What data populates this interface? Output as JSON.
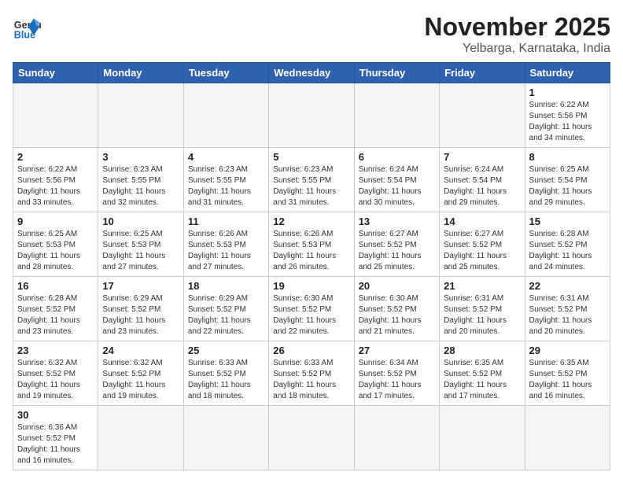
{
  "logo": {
    "text_general": "General",
    "text_blue": "Blue"
  },
  "title": "November 2025",
  "location": "Yelbarga, Karnataka, India",
  "weekdays": [
    "Sunday",
    "Monday",
    "Tuesday",
    "Wednesday",
    "Thursday",
    "Friday",
    "Saturday"
  ],
  "days": [
    {
      "num": "",
      "sunrise": "",
      "sunset": "",
      "daylight": ""
    },
    {
      "num": "",
      "sunrise": "",
      "sunset": "",
      "daylight": ""
    },
    {
      "num": "",
      "sunrise": "",
      "sunset": "",
      "daylight": ""
    },
    {
      "num": "",
      "sunrise": "",
      "sunset": "",
      "daylight": ""
    },
    {
      "num": "",
      "sunrise": "",
      "sunset": "",
      "daylight": ""
    },
    {
      "num": "",
      "sunrise": "",
      "sunset": "",
      "daylight": ""
    },
    {
      "num": "1",
      "sunrise": "Sunrise: 6:22 AM",
      "sunset": "Sunset: 5:56 PM",
      "daylight": "Daylight: 11 hours and 34 minutes."
    },
    {
      "num": "2",
      "sunrise": "Sunrise: 6:22 AM",
      "sunset": "Sunset: 5:56 PM",
      "daylight": "Daylight: 11 hours and 33 minutes."
    },
    {
      "num": "3",
      "sunrise": "Sunrise: 6:23 AM",
      "sunset": "Sunset: 5:55 PM",
      "daylight": "Daylight: 11 hours and 32 minutes."
    },
    {
      "num": "4",
      "sunrise": "Sunrise: 6:23 AM",
      "sunset": "Sunset: 5:55 PM",
      "daylight": "Daylight: 11 hours and 31 minutes."
    },
    {
      "num": "5",
      "sunrise": "Sunrise: 6:23 AM",
      "sunset": "Sunset: 5:55 PM",
      "daylight": "Daylight: 11 hours and 31 minutes."
    },
    {
      "num": "6",
      "sunrise": "Sunrise: 6:24 AM",
      "sunset": "Sunset: 5:54 PM",
      "daylight": "Daylight: 11 hours and 30 minutes."
    },
    {
      "num": "7",
      "sunrise": "Sunrise: 6:24 AM",
      "sunset": "Sunset: 5:54 PM",
      "daylight": "Daylight: 11 hours and 29 minutes."
    },
    {
      "num": "8",
      "sunrise": "Sunrise: 6:25 AM",
      "sunset": "Sunset: 5:54 PM",
      "daylight": "Daylight: 11 hours and 29 minutes."
    },
    {
      "num": "9",
      "sunrise": "Sunrise: 6:25 AM",
      "sunset": "Sunset: 5:53 PM",
      "daylight": "Daylight: 11 hours and 28 minutes."
    },
    {
      "num": "10",
      "sunrise": "Sunrise: 6:25 AM",
      "sunset": "Sunset: 5:53 PM",
      "daylight": "Daylight: 11 hours and 27 minutes."
    },
    {
      "num": "11",
      "sunrise": "Sunrise: 6:26 AM",
      "sunset": "Sunset: 5:53 PM",
      "daylight": "Daylight: 11 hours and 27 minutes."
    },
    {
      "num": "12",
      "sunrise": "Sunrise: 6:26 AM",
      "sunset": "Sunset: 5:53 PM",
      "daylight": "Daylight: 11 hours and 26 minutes."
    },
    {
      "num": "13",
      "sunrise": "Sunrise: 6:27 AM",
      "sunset": "Sunset: 5:52 PM",
      "daylight": "Daylight: 11 hours and 25 minutes."
    },
    {
      "num": "14",
      "sunrise": "Sunrise: 6:27 AM",
      "sunset": "Sunset: 5:52 PM",
      "daylight": "Daylight: 11 hours and 25 minutes."
    },
    {
      "num": "15",
      "sunrise": "Sunrise: 6:28 AM",
      "sunset": "Sunset: 5:52 PM",
      "daylight": "Daylight: 11 hours and 24 minutes."
    },
    {
      "num": "16",
      "sunrise": "Sunrise: 6:28 AM",
      "sunset": "Sunset: 5:52 PM",
      "daylight": "Daylight: 11 hours and 23 minutes."
    },
    {
      "num": "17",
      "sunrise": "Sunrise: 6:29 AM",
      "sunset": "Sunset: 5:52 PM",
      "daylight": "Daylight: 11 hours and 23 minutes."
    },
    {
      "num": "18",
      "sunrise": "Sunrise: 6:29 AM",
      "sunset": "Sunset: 5:52 PM",
      "daylight": "Daylight: 11 hours and 22 minutes."
    },
    {
      "num": "19",
      "sunrise": "Sunrise: 6:30 AM",
      "sunset": "Sunset: 5:52 PM",
      "daylight": "Daylight: 11 hours and 22 minutes."
    },
    {
      "num": "20",
      "sunrise": "Sunrise: 6:30 AM",
      "sunset": "Sunset: 5:52 PM",
      "daylight": "Daylight: 11 hours and 21 minutes."
    },
    {
      "num": "21",
      "sunrise": "Sunrise: 6:31 AM",
      "sunset": "Sunset: 5:52 PM",
      "daylight": "Daylight: 11 hours and 20 minutes."
    },
    {
      "num": "22",
      "sunrise": "Sunrise: 6:31 AM",
      "sunset": "Sunset: 5:52 PM",
      "daylight": "Daylight: 11 hours and 20 minutes."
    },
    {
      "num": "23",
      "sunrise": "Sunrise: 6:32 AM",
      "sunset": "Sunset: 5:52 PM",
      "daylight": "Daylight: 11 hours and 19 minutes."
    },
    {
      "num": "24",
      "sunrise": "Sunrise: 6:32 AM",
      "sunset": "Sunset: 5:52 PM",
      "daylight": "Daylight: 11 hours and 19 minutes."
    },
    {
      "num": "25",
      "sunrise": "Sunrise: 6:33 AM",
      "sunset": "Sunset: 5:52 PM",
      "daylight": "Daylight: 11 hours and 18 minutes."
    },
    {
      "num": "26",
      "sunrise": "Sunrise: 6:33 AM",
      "sunset": "Sunset: 5:52 PM",
      "daylight": "Daylight: 11 hours and 18 minutes."
    },
    {
      "num": "27",
      "sunrise": "Sunrise: 6:34 AM",
      "sunset": "Sunset: 5:52 PM",
      "daylight": "Daylight: 11 hours and 17 minutes."
    },
    {
      "num": "28",
      "sunrise": "Sunrise: 6:35 AM",
      "sunset": "Sunset: 5:52 PM",
      "daylight": "Daylight: 11 hours and 17 minutes."
    },
    {
      "num": "29",
      "sunrise": "Sunrise: 6:35 AM",
      "sunset": "Sunset: 5:52 PM",
      "daylight": "Daylight: 11 hours and 16 minutes."
    },
    {
      "num": "30",
      "sunrise": "Sunrise: 6:36 AM",
      "sunset": "Sunset: 5:52 PM",
      "daylight": "Daylight: 11 hours and 16 minutes."
    }
  ]
}
